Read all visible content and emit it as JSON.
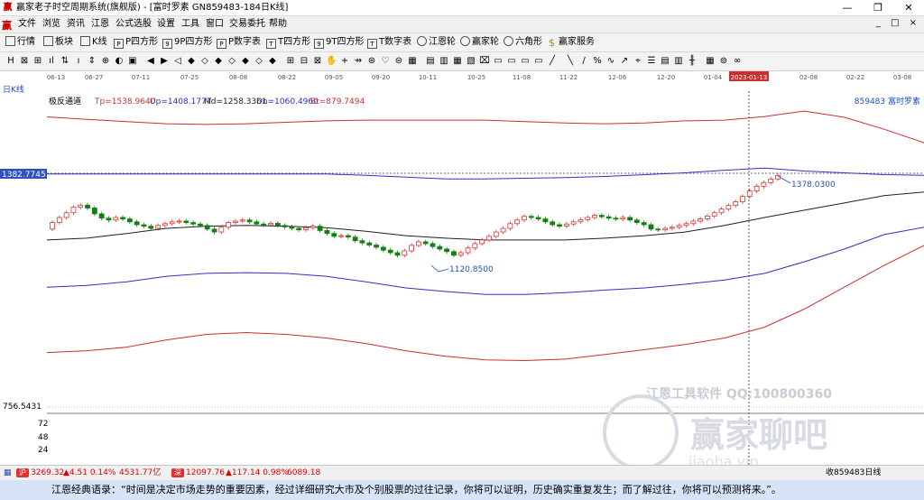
{
  "window": {
    "title": "赢家老子时空周期系统(旗舰版) - [富时罗素 GN859483-184日K线]",
    "minimize": "—",
    "restore": "❐",
    "close": "✕"
  },
  "menubar": {
    "items": [
      "文件",
      "浏览",
      "资讯",
      "江恩",
      "公式选股",
      "设置",
      "工具",
      "窗口",
      "交易委托",
      "帮助"
    ],
    "right_buttons": "_ □ ×"
  },
  "toolbar1": {
    "items": [
      {
        "label": "行情",
        "icon": "grid-icon"
      },
      {
        "label": "板块",
        "icon": "blocks-icon"
      },
      {
        "label": "K线",
        "icon": "candles-icon"
      },
      {
        "label": "P四方形",
        "icon": "p-square-icon"
      },
      {
        "label": "9P四方形",
        "icon": "9p-square-icon"
      },
      {
        "label": "P数字表",
        "icon": "p-table-icon"
      },
      {
        "label": "T四方形",
        "icon": "t-square-icon"
      },
      {
        "label": "9T四方形",
        "icon": "9t-square-icon"
      },
      {
        "label": "T数字表",
        "icon": "t-table-icon"
      },
      {
        "label": "江恩轮",
        "icon": "gann-wheel-icon"
      },
      {
        "label": "赢家轮",
        "icon": "winner-wheel-icon"
      },
      {
        "label": "六角形",
        "icon": "hexagon-icon"
      },
      {
        "label": "赢家服务",
        "icon": "dollar-icon"
      }
    ]
  },
  "toolbar2": {
    "icons": [
      "H",
      "⊠",
      "⊞",
      "ıl",
      "⇅",
      "ı",
      "⇕",
      "⊕",
      "◐",
      "▣",
      "◀",
      "▶",
      "◁",
      "◆",
      "◇",
      "◆",
      "◇",
      "◆",
      "◇",
      "◆",
      "⊞",
      "⊟",
      "⊠",
      "✋",
      "+",
      "⇸",
      "⊛",
      "♡",
      "⊜",
      "▦",
      "▤",
      "▥",
      "▦",
      "▧",
      "⌧",
      "▭",
      "▭",
      "▭",
      "▭",
      "╱",
      "╲",
      "/",
      "%",
      "∿",
      "↗",
      "⌖",
      "☰",
      "▤",
      "▥",
      "╫",
      "▦",
      "⊚",
      "∞"
    ]
  },
  "chart": {
    "period_label": "日K线",
    "indicator_name": "极反通道",
    "tp": "Tp=1538.9640",
    "up": "Up=1408.1777",
    "md": "Md=1258.3361",
    "dn": "Dn=1060.4960",
    "bt": "Bt=879.7494",
    "code_name": "859483  富时罗素",
    "price_tag": "1382.7745",
    "bottom_price": "756.5431",
    "high_label": "1378.0300",
    "low_label": "1120.8500",
    "volume_ticks": [
      "72",
      "48",
      "24"
    ],
    "date_ticks": [
      "06-13",
      "06-27",
      "07-11",
      "07-25",
      "08-08",
      "08-22",
      "09-05",
      "09-20",
      "10-11",
      "10-25",
      "11-08",
      "11-22",
      "12-06",
      "12-20",
      "01-04",
      "01-13",
      "02-08",
      "02-22",
      "03-08"
    ],
    "current_date": "2023-01-13",
    "watermark_1": "江恩工具软件  QQ:100800360",
    "watermark_2": "赢家聊吧",
    "watermark_3": "jiaoba.vip"
  },
  "chart_data": {
    "type": "line",
    "title": "极反通道",
    "lines": [
      {
        "name": "Tp",
        "color": "#c83030",
        "values": [
          1538.9,
          1532.0,
          1526.0,
          1520.0,
          1518.0,
          1520.0,
          1524.0,
          1528.0,
          1530.0,
          1530.0,
          1530.0,
          1530.0,
          1526.0,
          1522.0,
          1520.0,
          1522.0,
          1528.0,
          1530.0,
          1540.0,
          1555.0,
          1538.0,
          1505.0,
          1468.0
        ]
      },
      {
        "name": "Up",
        "color": "#3030c0",
        "values": [
          1382.0,
          1382.0,
          1382.0,
          1382.0,
          1382.0,
          1382.0,
          1382.0,
          1382.0,
          1378.0,
          1373.0,
          1368.0,
          1368.0,
          1370.0,
          1372.0,
          1375.0,
          1380.0,
          1385.0,
          1392.0,
          1398.0,
          1390.0,
          1385.0,
          1380.0,
          1378.0
        ]
      },
      {
        "name": "Md",
        "color": "#202020",
        "values": [
          1200.0,
          1205.0,
          1218.0,
          1232.0,
          1238.0,
          1240.0,
          1238.0,
          1234.0,
          1224.0,
          1212.0,
          1205.0,
          1200.0,
          1200.0,
          1200.0,
          1205.0,
          1212.0,
          1222.0,
          1240.0,
          1262.0,
          1282.0,
          1302.0,
          1322.0,
          1332.0
        ]
      },
      {
        "name": "Dn",
        "color": "#3030c0",
        "values": [
          1070.0,
          1075.0,
          1085.0,
          1100.0,
          1108.0,
          1110.0,
          1108.0,
          1100.0,
          1085.0,
          1068.0,
          1058.0,
          1050.0,
          1050.0,
          1055.0,
          1062.0,
          1068.0,
          1078.0,
          1090.0,
          1108.0,
          1140.0,
          1175.0,
          1215.0,
          1235.0
        ]
      },
      {
        "name": "Bt",
        "color": "#c83030",
        "values": [
          890.0,
          895.0,
          905.0,
          925.0,
          940.0,
          945.0,
          940.0,
          930.0,
          915.0,
          895.0,
          880.0,
          870.0,
          868.0,
          872.0,
          885.0,
          898.0,
          912.0,
          930.0,
          960.0,
          1010.0,
          1070.0,
          1130.0,
          1185.0
        ]
      }
    ],
    "candles": {
      "open": [
        1230.0,
        1248.0,
        1262.0,
        1275.0,
        1290.0,
        1296.0,
        1288.0,
        1272.0,
        1260.0,
        1255.0,
        1262.0,
        1258.0,
        1250.0,
        1242.0,
        1238.0,
        1232.0,
        1240.0,
        1245.0,
        1250.0,
        1252.0,
        1248.0,
        1244.0,
        1240.0,
        1230.0,
        1222.0,
        1235.0,
        1248.0,
        1252.0,
        1255.0,
        1250.0,
        1244.0,
        1242.0,
        1246.0,
        1240.0,
        1236.0,
        1232.0,
        1228.0,
        1234.0,
        1238.0,
        1226.0,
        1218.0,
        1210.0,
        1212.0,
        1208.0,
        1198.0,
        1192.0,
        1186.0,
        1180.0,
        1172.0,
        1165.0,
        1158.0,
        1170.0,
        1185.0,
        1195.0,
        1190.0,
        1182.0,
        1175.0,
        1168.0,
        1158.0,
        1165.0,
        1178.0,
        1190.0,
        1200.0,
        1210.0,
        1222.0,
        1232.0,
        1245.0,
        1255.0,
        1265.0,
        1262.0,
        1258.0,
        1250.0,
        1242.0,
        1238.0,
        1244.0,
        1250.0,
        1256.0,
        1262.0,
        1268.0,
        1264.0,
        1260.0,
        1258.0,
        1262.0,
        1255.0,
        1248.0,
        1242.0,
        1230.0,
        1228.0,
        1232.0,
        1235.0,
        1240.0,
        1245.0,
        1252.0,
        1258.0,
        1266.0,
        1275.0,
        1285.0,
        1295.0,
        1305.0,
        1320.0,
        1335.0,
        1348.0,
        1358.0,
        1368.0
      ],
      "close": [
        1248.0,
        1262.0,
        1275.0,
        1290.0,
        1296.0,
        1288.0,
        1272.0,
        1260.0,
        1255.0,
        1262.0,
        1258.0,
        1250.0,
        1242.0,
        1238.0,
        1232.0,
        1240.0,
        1245.0,
        1250.0,
        1252.0,
        1248.0,
        1244.0,
        1240.0,
        1230.0,
        1222.0,
        1235.0,
        1248.0,
        1252.0,
        1255.0,
        1250.0,
        1244.0,
        1242.0,
        1246.0,
        1240.0,
        1236.0,
        1232.0,
        1228.0,
        1234.0,
        1238.0,
        1226.0,
        1218.0,
        1210.0,
        1212.0,
        1208.0,
        1198.0,
        1192.0,
        1186.0,
        1180.0,
        1172.0,
        1165.0,
        1158.0,
        1170.0,
        1185.0,
        1195.0,
        1190.0,
        1182.0,
        1175.0,
        1168.0,
        1158.0,
        1165.0,
        1178.0,
        1190.0,
        1200.0,
        1210.0,
        1222.0,
        1232.0,
        1245.0,
        1255.0,
        1265.0,
        1262.0,
        1258.0,
        1250.0,
        1242.0,
        1238.0,
        1244.0,
        1250.0,
        1256.0,
        1262.0,
        1268.0,
        1264.0,
        1260.0,
        1258.0,
        1262.0,
        1255.0,
        1248.0,
        1242.0,
        1230.0,
        1228.0,
        1232.0,
        1235.0,
        1240.0,
        1245.0,
        1252.0,
        1258.0,
        1266.0,
        1275.0,
        1285.0,
        1295.0,
        1305.0,
        1320.0,
        1335.0,
        1348.0,
        1358.0,
        1368.0,
        1378.0
      ]
    },
    "ylim": [
      740,
      1580
    ]
  },
  "status": {
    "index1_value": "3269.32",
    "index1_change": "▲4.51 0.14%",
    "index1_amount": "4531.77亿",
    "index2_value": "12097.76",
    "index2_change": "▲117.14 0.98%",
    "index2_amount": "6089.18",
    "right_text": "收859483日线"
  },
  "quote": {
    "text": "江恩经典语录：“时间是决定市场走势的重要因素，经过详细研究大市及个别股票的过往记录，你将可以证明，历史确实重复发生；而了解过往，你将可以预测将来。”。"
  },
  "colors": {
    "red_line": "#c83030",
    "blue_line": "#3030c0",
    "up_candle": "#e03030",
    "down_candle": "#108010",
    "quote_bg": "#d7e4f7"
  }
}
